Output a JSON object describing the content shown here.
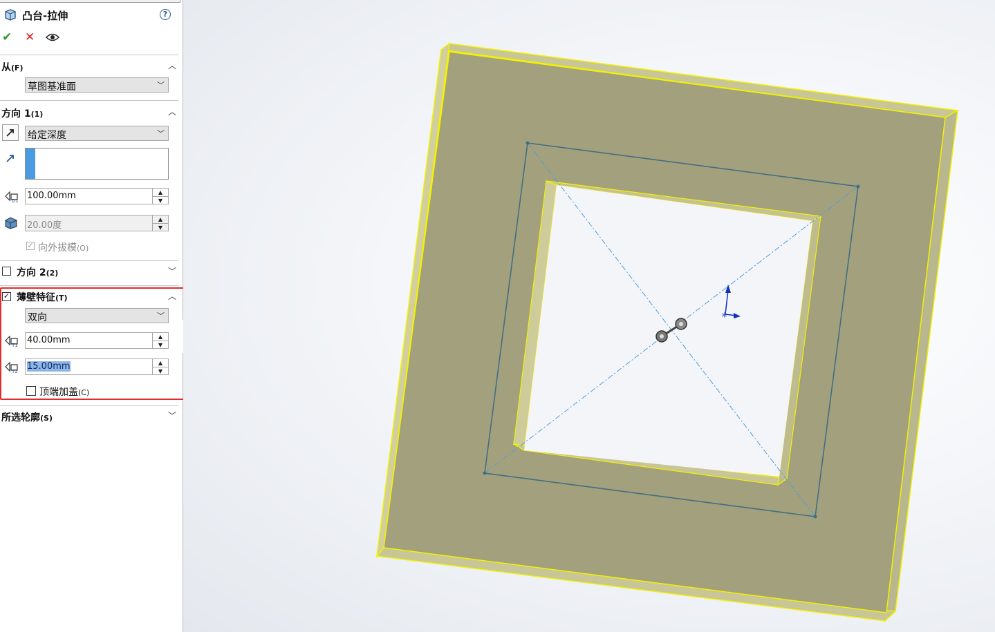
{
  "panel": {
    "title": "凸台-拉伸",
    "help_icon": "help-icon",
    "actions": {
      "ok": "✔",
      "cancel": "✕",
      "preview": "preview-eye-icon"
    },
    "from": {
      "header": "从",
      "shortcut": "(F)",
      "start_condition": "草图基准面"
    },
    "direction1": {
      "header": "方向 1",
      "shortcut": "(1)",
      "end_condition": "给定深度",
      "depth": "100.00mm",
      "draft_angle": "20.00度",
      "draft_outward_label": "向外拔模",
      "draft_outward_shortcut": "(O)"
    },
    "direction2": {
      "header": "方向 2",
      "shortcut": "(2)"
    },
    "thin_feature": {
      "header": "薄壁特征",
      "shortcut": "(T)",
      "type": "双向",
      "thickness1": "40.00mm",
      "thickness2": "15.00mm",
      "cap_ends_label": "顶端加盖",
      "cap_ends_shortcut": "(C)"
    },
    "selected_contours": {
      "header": "所选轮廓",
      "shortcut": "(S)"
    }
  },
  "colors": {
    "highlight_box": "#e52b2b",
    "part_face": "#a3a07d",
    "part_edge": "#f2f200",
    "sketch_line": "#4a9be0"
  }
}
